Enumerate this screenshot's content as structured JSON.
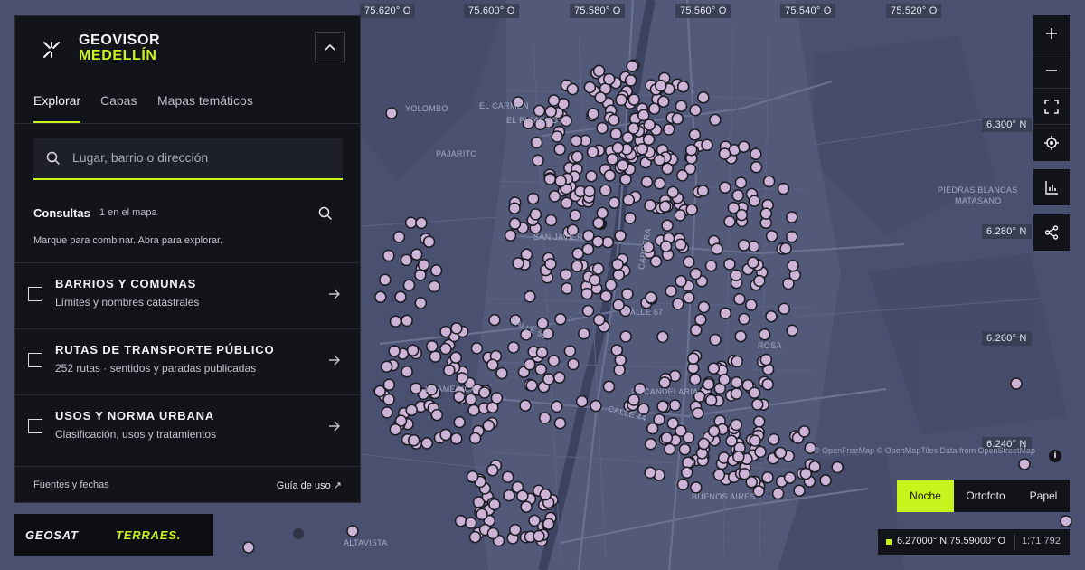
{
  "app": {
    "title_line1": "GEOVISOR",
    "title_line2": "MEDELLÍN"
  },
  "tabs": [
    {
      "label": "Explorar",
      "active": true
    },
    {
      "label": "Capas",
      "active": false
    },
    {
      "label": "Mapas temáticos",
      "active": false
    }
  ],
  "search": {
    "placeholder": "Lugar, barrio o dirección"
  },
  "consultas": {
    "title": "Consultas",
    "count": "1 en el mapa",
    "hint": "Marque para combinar. Abra para explorar."
  },
  "layers": [
    {
      "title": "BARRIOS Y COMUNAS",
      "subtitle": "Límites y nombres catastrales",
      "checked": false
    },
    {
      "title": "RUTAS DE TRANSPORTE PÚBLICO",
      "subtitle": "252 rutas · sentidos y paradas publicadas",
      "checked": false
    },
    {
      "title": "USOS Y NORMA URBANA",
      "subtitle": "Clasificación, usos y tratamientos",
      "checked": false
    }
  ],
  "footer": {
    "sources": "Fuentes y fechas",
    "guide": "Guía de uso ↗"
  },
  "partners": {
    "left": "GEOSAT",
    "right": "TERRAES."
  },
  "map": {
    "lon_labels": [
      "75.620° O",
      "75.600° O",
      "75.580° O",
      "75.560° O",
      "75.540° O",
      "75.520° O"
    ],
    "lat_labels": [
      "6.300° N",
      "6.280° N",
      "6.260° N",
      "6.240° N"
    ],
    "place_labels": [
      "YOLOMBO",
      "EL CARMEN",
      "EL PICACHO",
      "PAJARITO",
      "CARRERA",
      "CALLE 67",
      "CALLE 50",
      "CALLE 44",
      "LA CANDELARIA",
      "BUENOS AIRES",
      "ALTAVISTA",
      "PIEDRAS BLANCAS",
      "MATASANO",
      "LA AMÉRICA",
      "SAN JAVIER",
      "ROSA"
    ],
    "attribution": "© OpenFreeMap © OpenMapTiles Data from OpenStreetMap",
    "marker_color": "#cdb4d6"
  },
  "controls": {
    "zoom_in": "+",
    "zoom_out": "−"
  },
  "basemaps": [
    {
      "label": "Noche",
      "active": true
    },
    {
      "label": "Ortofoto",
      "active": false
    },
    {
      "label": "Papel",
      "active": false
    }
  ],
  "status": {
    "coords": "6.27000° N 75.59000° O",
    "scale": "1:71 792"
  },
  "colors": {
    "accent": "#c9f31d",
    "panel": "#121419",
    "map_bg": "#4a5070"
  }
}
